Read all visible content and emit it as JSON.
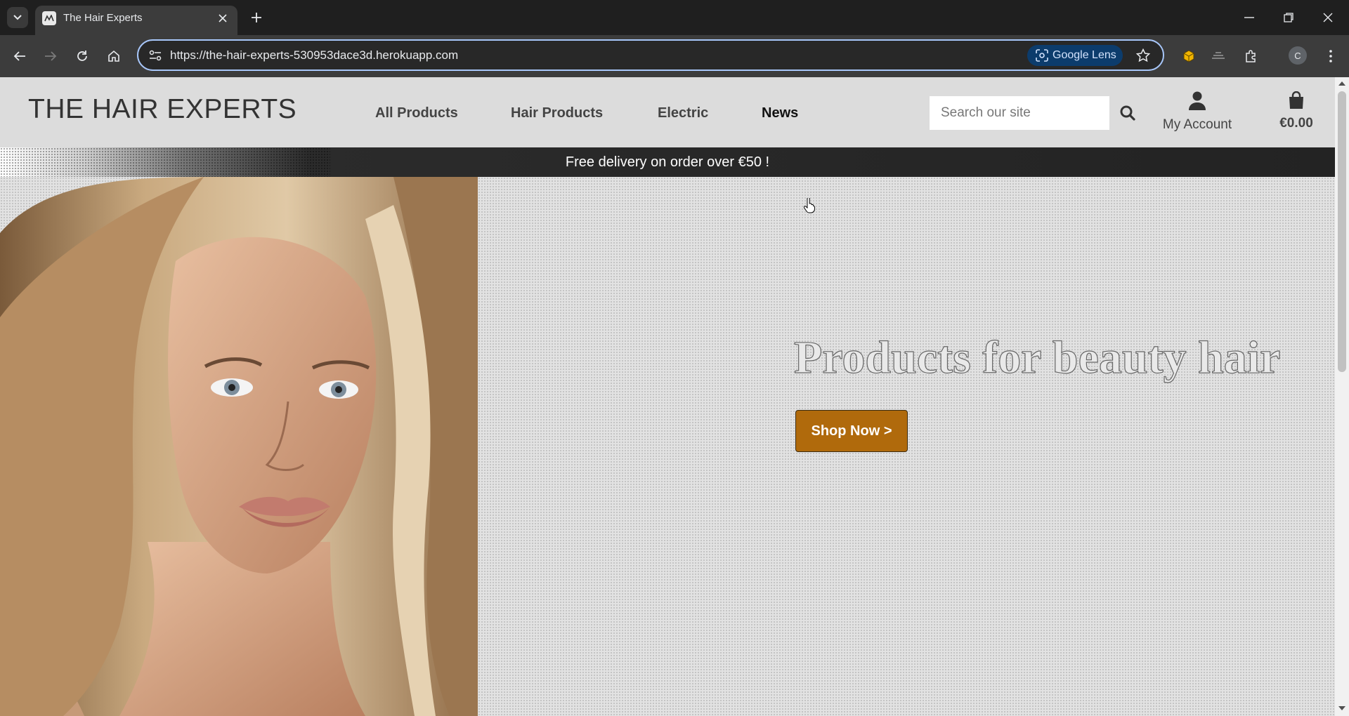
{
  "browser": {
    "tab_title": "The Hair Experts",
    "url": "https://the-hair-experts-530953dace3d.herokuapp.com",
    "lens_label": "Google Lens",
    "profile_initial": "C"
  },
  "site": {
    "logo": "THE HAIR EXPERTS",
    "nav": {
      "all_products": "All Products",
      "hair_products": "Hair Products",
      "electric": "Electric",
      "news": "News"
    },
    "search": {
      "placeholder": "Search our site"
    },
    "account_label": "My Account",
    "bag_total": "€0.00",
    "banner": "Free delivery on order over €50 !",
    "hero": {
      "title": "Products for beauty hair",
      "cta": "Shop Now >"
    }
  },
  "colors": {
    "accent": "#b06a0c",
    "header_bg": "#dcdcdc",
    "banner_bg": "#232323"
  }
}
